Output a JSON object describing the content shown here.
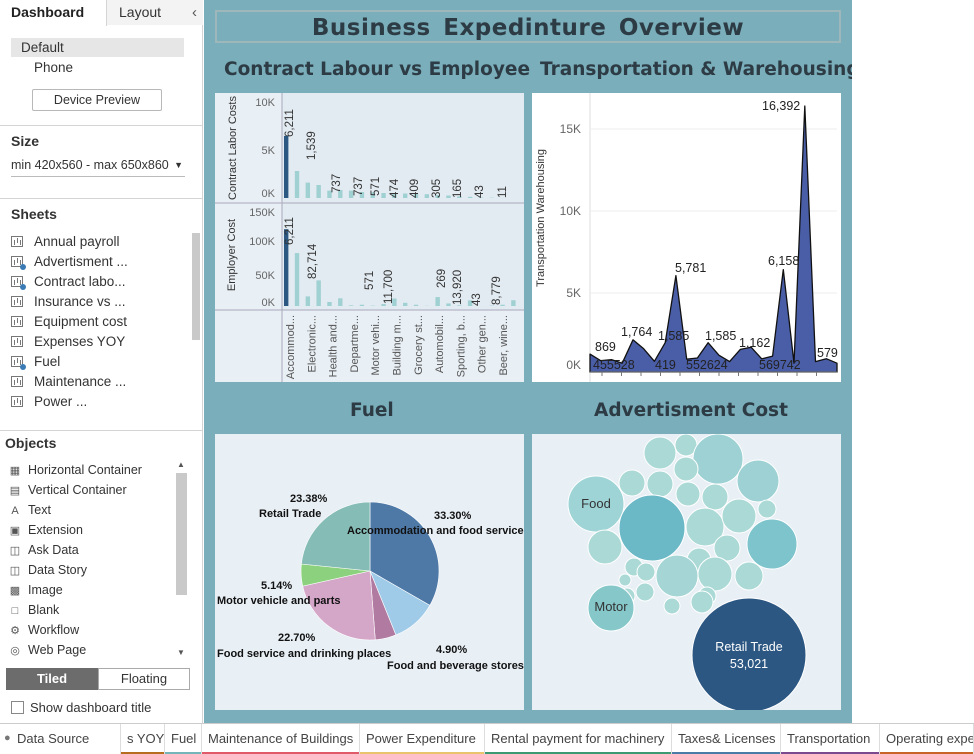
{
  "left_panel": {
    "tabs": {
      "dashboard": "Dashboard",
      "layout": "Layout"
    },
    "devices": [
      {
        "label": "Default",
        "selected": true
      },
      {
        "label": "Phone",
        "selected": false
      }
    ],
    "device_preview": "Device Preview",
    "size": {
      "heading": "Size",
      "value": "min 420x560 - max 650x860"
    },
    "sheets": {
      "heading": "Sheets",
      "items": [
        {
          "label": "Annual payroll",
          "used": false
        },
        {
          "label": "Advertisment ...",
          "used": true
        },
        {
          "label": "Contract  labo...",
          "used": true
        },
        {
          "label": "Insurance  vs  ...",
          "used": false
        },
        {
          "label": "Equipment cost",
          "used": false
        },
        {
          "label": "Expenses  YOY",
          "used": false
        },
        {
          "label": "Fuel",
          "used": true
        },
        {
          "label": "Maintenance ...",
          "used": false
        },
        {
          "label": "Power  ...",
          "used": false
        }
      ]
    },
    "objects": {
      "heading": "Objects",
      "items": [
        {
          "label": "Horizontal Container",
          "icon": "horizontal-container-icon"
        },
        {
          "label": "Vertical Container",
          "icon": "vertical-container-icon"
        },
        {
          "label": "Text",
          "icon": "text-icon"
        },
        {
          "label": "Extension",
          "icon": "extension-icon"
        },
        {
          "label": "Ask Data",
          "icon": "ask-data-icon"
        },
        {
          "label": "Data Story",
          "icon": "data-story-icon"
        },
        {
          "label": "Image",
          "icon": "image-icon"
        },
        {
          "label": "Blank",
          "icon": "blank-icon"
        },
        {
          "label": "Workflow",
          "icon": "workflow-icon"
        },
        {
          "label": "Web Page",
          "icon": "web-page-icon"
        }
      ]
    },
    "tiled": "Tiled",
    "floating": "Floating",
    "show_title": "Show dashboard title"
  },
  "dashboard": {
    "title": "Business  Expedinture  Overview",
    "panels": {
      "contract": "Contract  Labour  vs  Employee",
      "transport": "Transportation & Warehousing",
      "fuel": "Fuel",
      "advert": "Advertisment  Cost"
    }
  },
  "colors": {
    "dashboard_bg": "#79aeba",
    "panel_bg": "#e8eff5",
    "dark_blue": "#2b5782",
    "light_teal": "#9fd0d2",
    "area_fill": "#4a5ea8"
  },
  "chart_data": [
    {
      "id": "contract-labor",
      "type": "bar",
      "ylabel_top": "Contract Labor Costs",
      "ylabel_bottom": "Employer Cost",
      "top_ticks": [
        "10K",
        "5K",
        "0K"
      ],
      "bottom_ticks": [
        "150K",
        "100K",
        "50K",
        "0K"
      ],
      "top_labels": [
        "6,211",
        "1,539",
        "737",
        "737",
        "571",
        "474",
        "409",
        "305",
        "165",
        "43",
        "11"
      ],
      "bottom_labels": [
        "6,211",
        "82,714",
        "571",
        "11,700",
        "269",
        "13,920",
        "43",
        "8,779"
      ],
      "categories": [
        "Accommod...",
        "Electronic...",
        "Health and...",
        "Departme...",
        "Motor vehi...",
        "Building m...",
        "Grocery st...",
        "Automobil...",
        "Sporting, b...",
        "Other gen...",
        "Beer, wine..."
      ],
      "top_values": [
        6211,
        2700,
        1539,
        1300,
        737,
        800,
        737,
        600,
        571,
        500,
        474,
        450,
        409,
        380,
        305,
        250,
        165,
        120,
        43,
        30,
        11
      ],
      "bottom_values": [
        120000,
        82714,
        15000,
        40000,
        6211,
        12000,
        1000,
        2000,
        571,
        3000,
        11700,
        5000,
        2000,
        269,
        13920,
        4000,
        1000,
        8779,
        43,
        500,
        2000,
        9000
      ],
      "top_ylim": [
        0,
        10000
      ],
      "bottom_ylim": [
        0,
        150000
      ]
    },
    {
      "id": "transportation",
      "type": "area",
      "ylabel": "Transportation  Warehousing",
      "yticks": [
        "15K",
        "10K",
        "5K",
        "0K"
      ],
      "ylim": [
        0,
        16392
      ],
      "values": [
        869,
        455,
        528,
        300,
        1764,
        1200,
        419,
        1585,
        5781,
        552,
        624,
        1585,
        800,
        400,
        1162,
        1300,
        569,
        742,
        6158,
        300,
        16392,
        400,
        579,
        300
      ],
      "labels": [
        "869",
        "455528",
        "1,764",
        "419",
        "1,585",
        "5,781",
        "552624",
        "1,585",
        "1,162",
        "569742",
        "6,158",
        "16,392",
        "579"
      ]
    },
    {
      "id": "fuel",
      "type": "pie",
      "slices": [
        {
          "name": "Accommodation and food services",
          "value": 33.3,
          "label": "33.30%",
          "color": "#4e79a7"
        },
        {
          "name": "Retail Trade",
          "value": 23.38,
          "label": "23.38%",
          "color": "#86bcb6"
        },
        {
          "name": "Motor vehicle and parts",
          "value": 5.14,
          "label": "5.14%",
          "color": "#8cd17d"
        },
        {
          "name": "Food service and drinking places",
          "value": 22.7,
          "label": "22.70%",
          "color": "#d4a6c8"
        },
        {
          "name": "Food and beverage stores",
          "value": 4.9,
          "label": "4.90%",
          "color": "#b07aa1"
        },
        {
          "name": "",
          "value": 10.58,
          "label": "",
          "color": "#a0cbe8"
        }
      ]
    },
    {
      "id": "advertisment",
      "type": "bubble",
      "labels": {
        "food": "Food",
        "motor": "Motor",
        "retail": "Retail Trade",
        "retail_value": "53,021"
      }
    }
  ],
  "bottom_tabs": [
    {
      "label": "Data Source",
      "color": "#ffffff"
    },
    {
      "label": "s  YOY",
      "color": "#b66d1d"
    },
    {
      "label": "Fuel",
      "color": "#74b5b9"
    },
    {
      "label": "Maintenance of Buildings",
      "color": "#e05a6a"
    },
    {
      "label": "Power  Expenditure",
      "color": "#e9c46a"
    },
    {
      "label": "Rental payment for machinery",
      "color": "#3b9a72"
    },
    {
      "label": "Taxes& Licenses",
      "color": "#4b7ca8"
    },
    {
      "label": "Transportation",
      "color": "#7b4a8e"
    },
    {
      "label": "Operating  exper",
      "color": "#c8632a"
    }
  ]
}
